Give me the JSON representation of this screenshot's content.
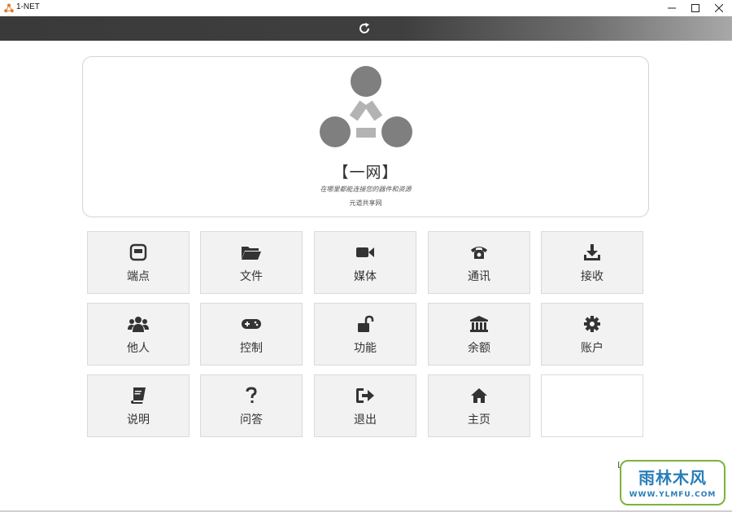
{
  "window": {
    "title": "1-NET",
    "minimize_glyph": "—",
    "maximize_glyph": "☐",
    "close_glyph": "✕"
  },
  "toolbar": {
    "refresh_icon": "refresh-icon"
  },
  "hero": {
    "title": "【一网】",
    "subtitle": "在哪里都能连接您的器件和资源",
    "small": "元道共享网",
    "logo_colors": {
      "circle": "#7f7f7f",
      "link": "#b3b3b3"
    }
  },
  "tiles": [
    {
      "label": "端点",
      "icon": "endpoint-icon"
    },
    {
      "label": "文件",
      "icon": "folder-icon"
    },
    {
      "label": "媒体",
      "icon": "video-camera-icon"
    },
    {
      "label": "通讯",
      "icon": "phone-icon"
    },
    {
      "label": "接收",
      "icon": "download-icon"
    },
    {
      "label": "他人",
      "icon": "users-icon"
    },
    {
      "label": "控制",
      "icon": "gamepad-icon"
    },
    {
      "label": "功能",
      "icon": "unlock-icon"
    },
    {
      "label": "余额",
      "icon": "bank-icon"
    },
    {
      "label": "账户",
      "icon": "gear-icon"
    },
    {
      "label": "说明",
      "icon": "book-icon"
    },
    {
      "label": "问答",
      "icon": "question-icon"
    },
    {
      "label": "退出",
      "icon": "sign-out-icon"
    },
    {
      "label": "主页",
      "icon": "home-icon"
    },
    {
      "label": "",
      "icon": ""
    }
  ],
  "watermark": {
    "main": "雨林木风",
    "sub": "WWW.YLMFU.COM"
  },
  "cursor_text": "L"
}
